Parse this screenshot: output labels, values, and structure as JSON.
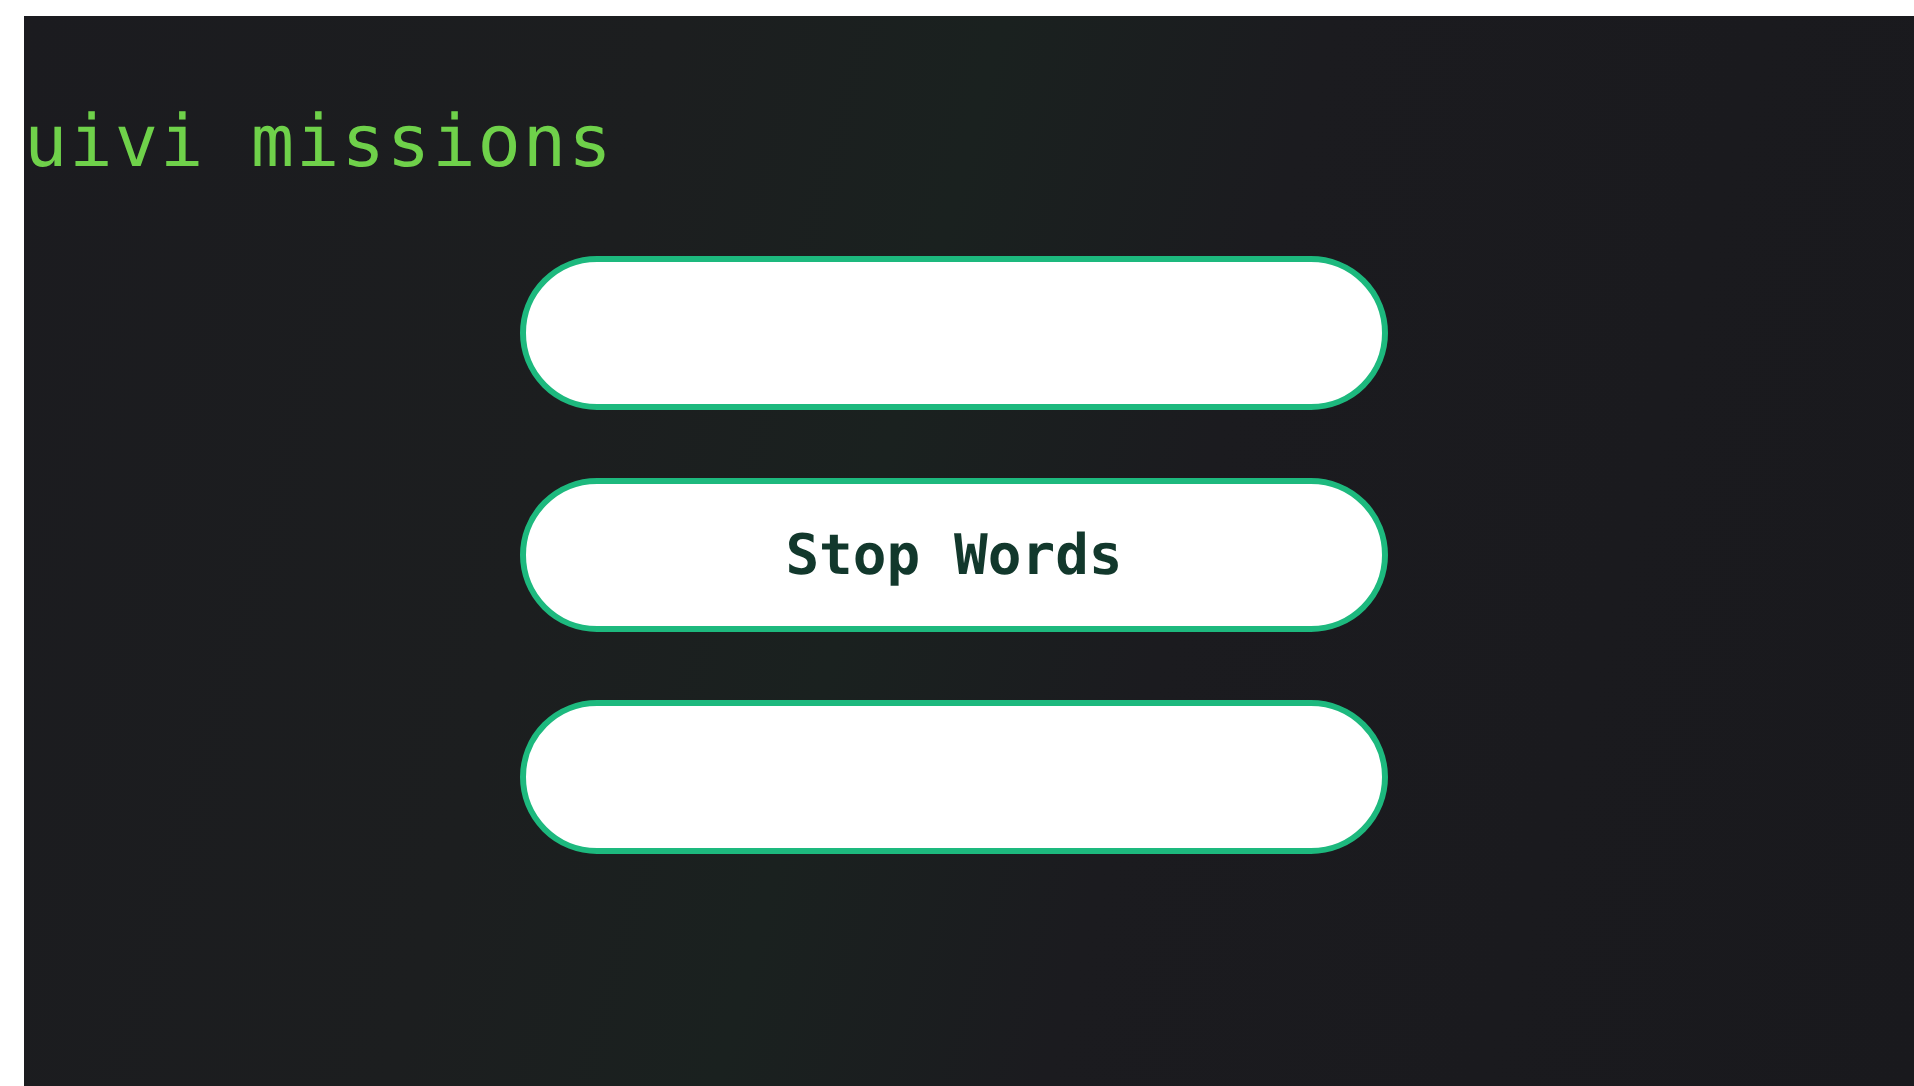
{
  "title": "uivi missions",
  "buttons": [
    {
      "kind": "blank"
    },
    {
      "kind": "labeled",
      "label": "Stop Words"
    },
    {
      "kind": "blank"
    }
  ]
}
